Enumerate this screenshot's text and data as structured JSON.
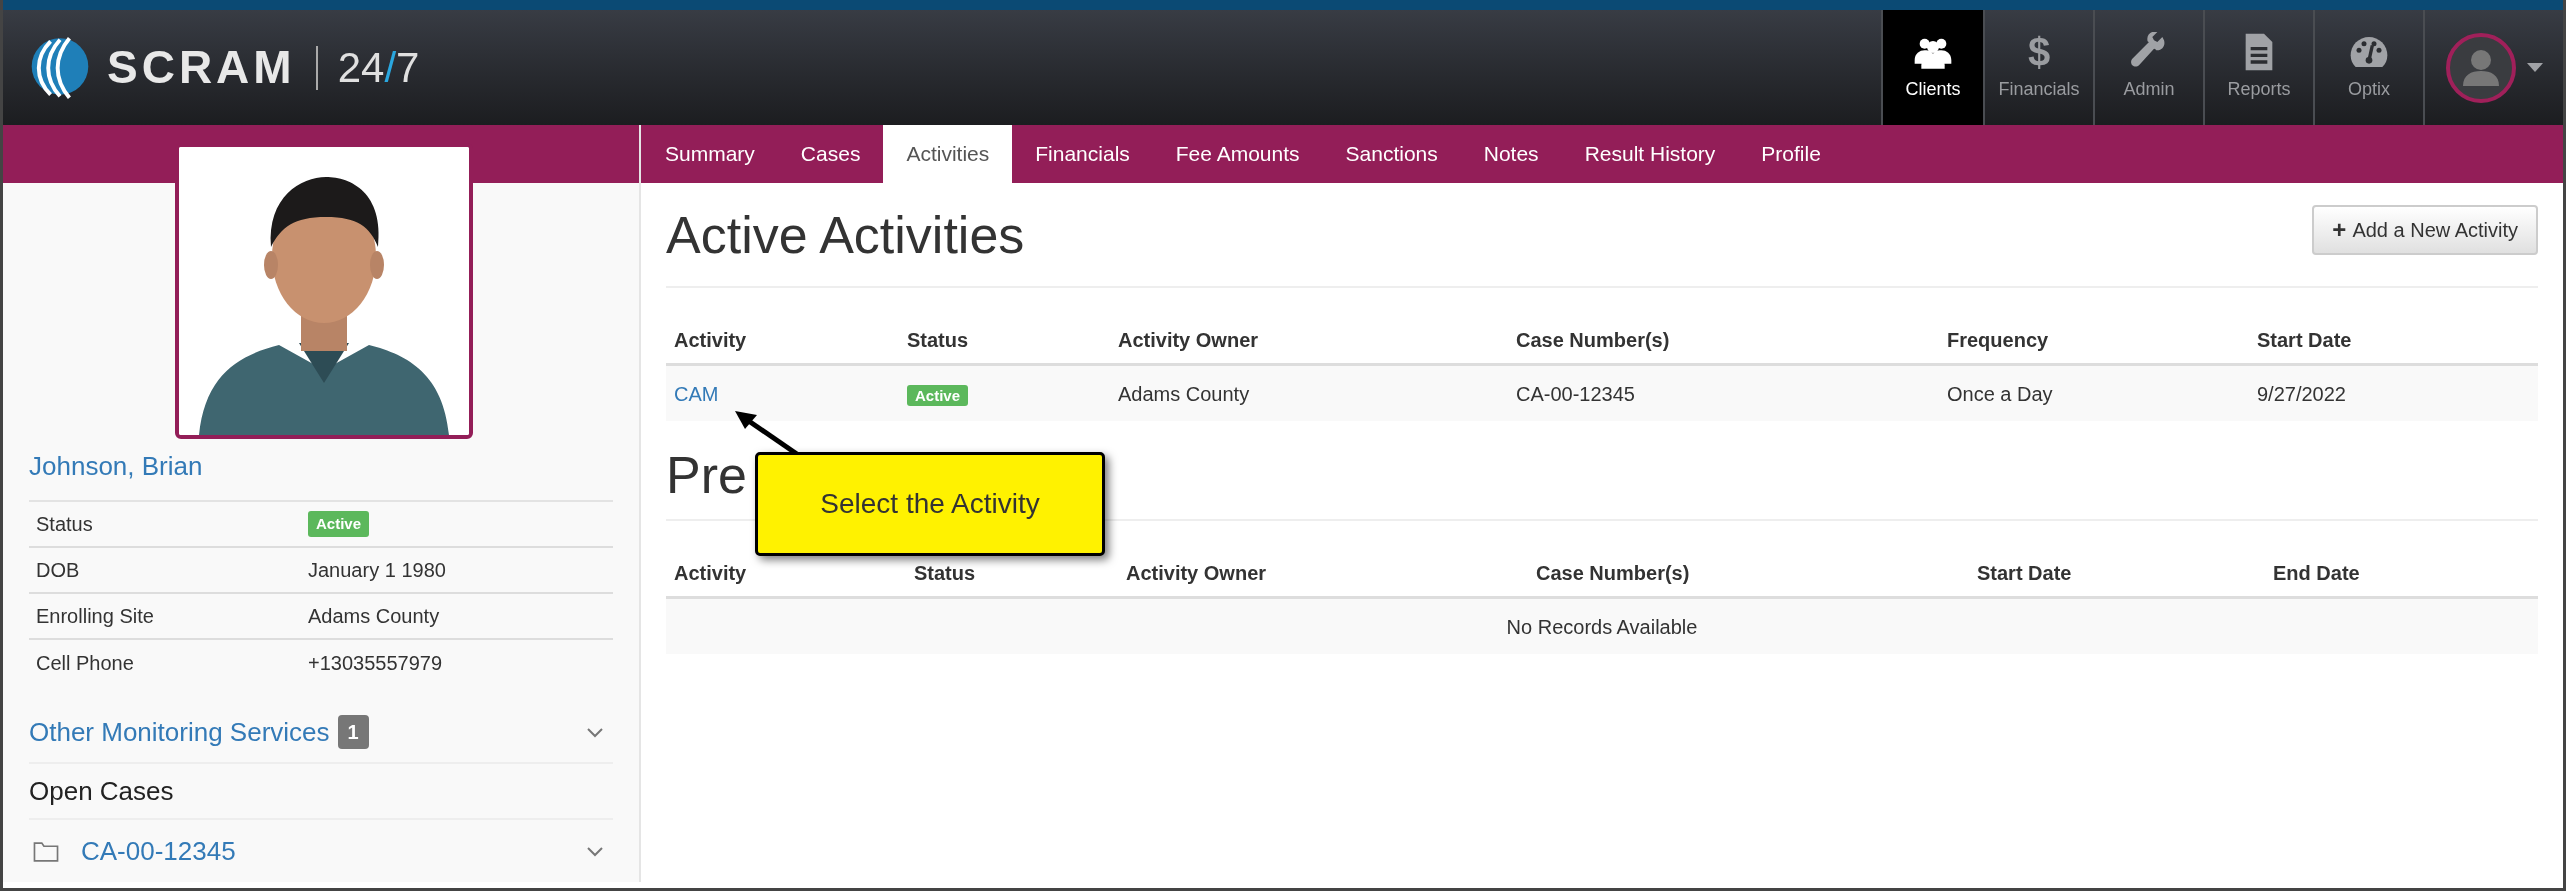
{
  "logo": {
    "brand": "SCRAM",
    "product_start": "24",
    "product_slash": "/",
    "product_end": "7"
  },
  "nav": [
    {
      "label": "Clients",
      "kind": "people",
      "selected": true
    },
    {
      "label": "Financials",
      "kind": "dollar",
      "glyph": "$",
      "selected": false
    },
    {
      "label": "Admin",
      "kind": "wrench",
      "selected": false
    },
    {
      "label": "Reports",
      "kind": "document",
      "selected": false
    },
    {
      "label": "Optix",
      "kind": "gauge",
      "selected": false
    }
  ],
  "client": {
    "name": "Johnson, Brian",
    "details": [
      {
        "label": "Status",
        "value": "Active",
        "kind": "badge"
      },
      {
        "label": "DOB",
        "value": "January 1 1980",
        "kind": "text"
      },
      {
        "label": "Enrolling Site",
        "value": "Adams County",
        "kind": "text"
      },
      {
        "label": "Cell Phone",
        "value": "+13035557979",
        "kind": "text"
      }
    ],
    "other_services": {
      "title": "Other Monitoring Services",
      "count": "1",
      "expanded": false
    },
    "open_cases": {
      "title": "Open Cases",
      "items": [
        {
          "label": "CA-00-12345",
          "expanded": false
        }
      ]
    }
  },
  "tabs": [
    {
      "label": "Summary",
      "selected": false
    },
    {
      "label": "Cases",
      "selected": false
    },
    {
      "label": "Activities",
      "selected": true
    },
    {
      "label": "Financials",
      "selected": false
    },
    {
      "label": "Fee Amounts",
      "selected": false
    },
    {
      "label": "Sanctions",
      "selected": false
    },
    {
      "label": "Notes",
      "selected": false
    },
    {
      "label": "Result History",
      "selected": false
    },
    {
      "label": "Profile",
      "selected": false
    }
  ],
  "active": {
    "title": "Active Activities",
    "add_button": {
      "icon": "+",
      "label": "Add a New Activity"
    },
    "columns": [
      "Activity",
      "Status",
      "Activity Owner",
      "Case Number(s)",
      "Frequency",
      "Start Date"
    ],
    "rows": [
      {
        "activity": "CAM",
        "status": "Active",
        "owner": "Adams County",
        "cases": "CA-00-12345",
        "frequency": "Once a Day",
        "start": "9/27/2022"
      }
    ]
  },
  "previous": {
    "title": "Pre",
    "columns": [
      "Activity",
      "Status",
      "Activity Owner",
      "Case Number(s)",
      "Start Date",
      "End Date"
    ],
    "empty": "No Records Available"
  },
  "callout": {
    "text": "Select the Activity"
  }
}
